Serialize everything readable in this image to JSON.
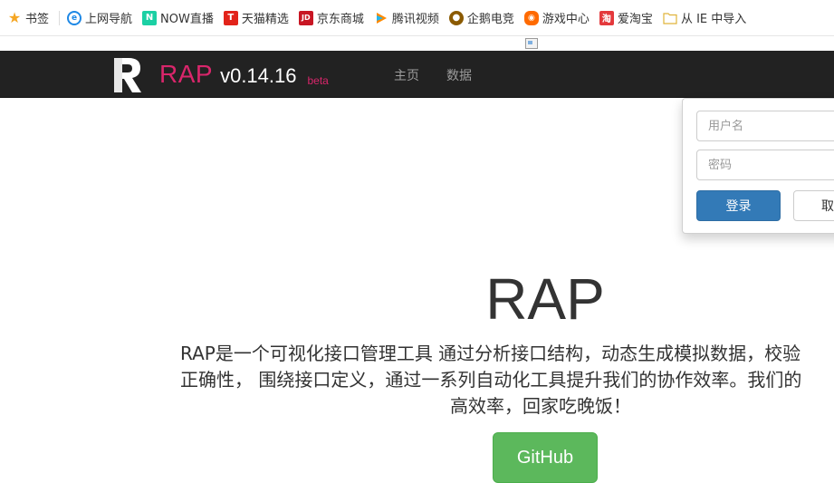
{
  "bookmarks": [
    {
      "label": "书签",
      "icon": "star-icon",
      "color": "#f5a623"
    },
    {
      "label": "上网导航",
      "icon": "ie-icon",
      "color": "#1e88e5"
    },
    {
      "label": "NOW直播",
      "icon": "now-icon",
      "color": "#1bd0a4"
    },
    {
      "label": "天猫精选",
      "icon": "tmall-icon",
      "color": "#e2231a"
    },
    {
      "label": "京东商城",
      "icon": "jd-icon",
      "color": "#c81623"
    },
    {
      "label": "腾讯视频",
      "icon": "tencent-video-icon",
      "color": "#ff8a00"
    },
    {
      "label": "企鹅电竞",
      "icon": "penguin-esports-icon",
      "color": "#8b5a00"
    },
    {
      "label": "游戏中心",
      "icon": "gamepad-icon",
      "color": "#ff6a00"
    },
    {
      "label": "爱淘宝",
      "icon": "taobao-icon",
      "color": "#e4393c"
    },
    {
      "label": "从 IE 中导入",
      "icon": "folder-icon",
      "color": "#f2c94c"
    }
  ],
  "navbar": {
    "brand_name": "RAP",
    "version": "v0.14.16",
    "beta": "beta",
    "links": [
      "主页",
      "数据"
    ]
  },
  "login": {
    "username_placeholder": "用户名",
    "password_placeholder": "密码",
    "login_label": "登录",
    "cancel_label": "取"
  },
  "hero": {
    "title": "RAP",
    "lines": [
      "RAP是一个可视化接口管理工具 通过分析接口结构，动态生成模拟数据，校验",
      "正确性， 围绕接口定义，通过一系列自动化工具提升我们的协作效率。我们的",
      "高效率，回家吃晚饭！"
    ],
    "github_label": "GitHub"
  },
  "colors": {
    "navbar_bg": "#222222",
    "brand": "#d9266b",
    "primary": "#337ab7",
    "success": "#5cb85c"
  }
}
